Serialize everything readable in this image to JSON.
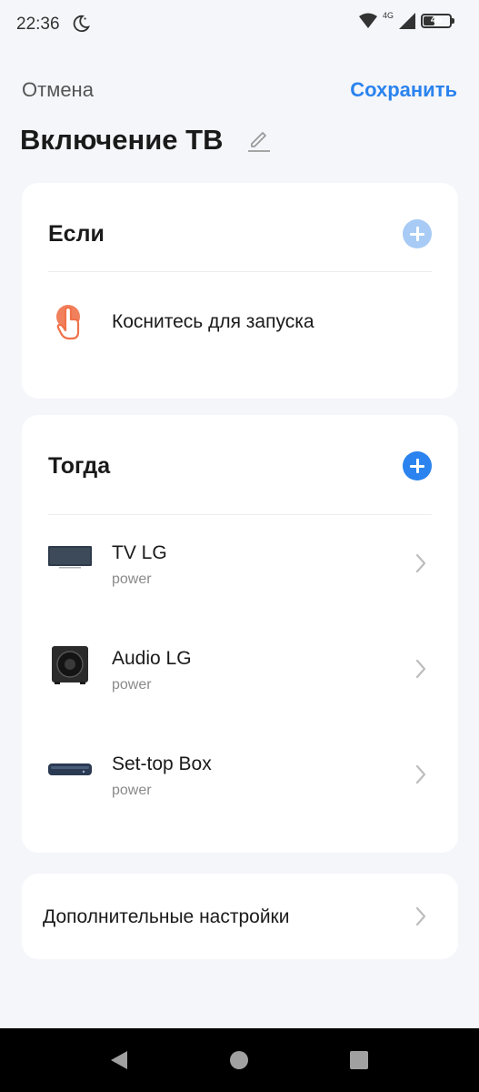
{
  "status_bar": {
    "time": "22:36",
    "network_label": "4G",
    "battery": "46",
    "battery_level": 0.46,
    "icons": [
      "moon-icon",
      "wifi-icon",
      "cell-signal-icon",
      "battery-icon"
    ]
  },
  "header": {
    "cancel_label": "Отмена",
    "save_label": "Сохранить",
    "title": "Включение ТВ"
  },
  "if_section": {
    "title": "Если",
    "trigger_label": "Коснитесь для запуска"
  },
  "then_section": {
    "title": "Тогда",
    "devices": [
      {
        "name": "TV LG",
        "action": "power",
        "icon": "tv-icon"
      },
      {
        "name": "Audio LG",
        "action": "power",
        "icon": "speaker-icon"
      },
      {
        "name": "Set-top Box",
        "action": "power",
        "icon": "set-top-box-icon"
      }
    ]
  },
  "extra": {
    "label": "Дополнительные настройки"
  },
  "colors": {
    "accent": "#2a83ee",
    "accent_disabled": "#a7cbf5",
    "touch_icon": "#f0724a",
    "background": "#f5f6fa"
  }
}
